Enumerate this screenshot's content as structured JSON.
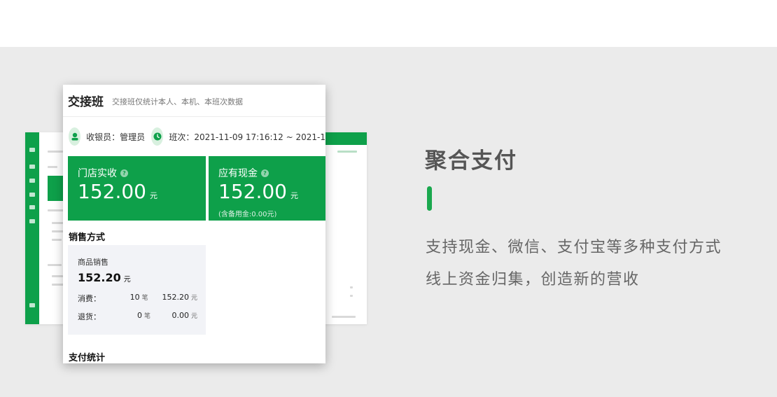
{
  "colors": {
    "brand_green": "#0ea04a",
    "accent_bar": "#1aa84e",
    "band_gray": "#ebebeb"
  },
  "panel": {
    "title": "交接班",
    "subtitle": "交接班仅统计本人、本机、本班次数据",
    "cashier_icon": "user-badge-icon",
    "cashier_text": "收银员：管理员",
    "shift_icon": "clock-icon",
    "shift_text": "班次：2021-11-09 17:16:12 ~ 2021-1"
  },
  "cards": [
    {
      "label": "门店实收",
      "amount": "152.00",
      "unit": "元",
      "note": ""
    },
    {
      "label": "应有现金",
      "amount": "152.00",
      "unit": "元",
      "note": "(含备用金:0.00元)"
    }
  ],
  "sales_section": {
    "title": "销售方式",
    "box": {
      "label": "商品销售",
      "amount": "152.20",
      "unit": "元",
      "rows": [
        {
          "key": "消费：",
          "count": "10",
          "count_unit": "笔",
          "amount": "152.20",
          "amount_unit": "元"
        },
        {
          "key": "退货：",
          "count": "0",
          "count_unit": "笔",
          "amount": "0.00",
          "amount_unit": "元"
        }
      ]
    }
  },
  "payment_section": {
    "title": "支付统计"
  },
  "marketing": {
    "headline": "聚合支付",
    "line1": "支持现金、微信、支付宝等多种支付方式",
    "line2": "线上资金归集，创造新的营收"
  }
}
